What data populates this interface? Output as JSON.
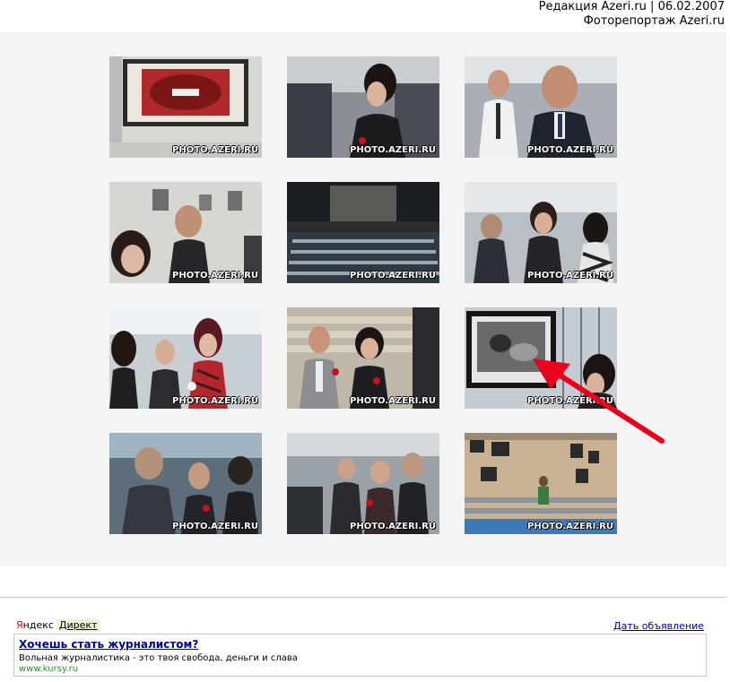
{
  "header": {
    "line1": "Редакция Azeri.ru | 06.02.2007",
    "line2": "Фоторепортаж Azeri.ru"
  },
  "gallery": {
    "watermark": "PHOTO.AZERI.RU",
    "photos": [
      {
        "scene": "framed-painting"
      },
      {
        "scene": "woman-dark-hair"
      },
      {
        "scene": "men-in-suits"
      },
      {
        "scene": "woman-and-man-gallery"
      },
      {
        "scene": "auditorium-screen"
      },
      {
        "scene": "crowd-reception"
      },
      {
        "scene": "women-guests"
      },
      {
        "scene": "couple-on-stairs"
      },
      {
        "scene": "framed-photo-with-arrow"
      },
      {
        "scene": "guests-standing"
      },
      {
        "scene": "seated-audience"
      },
      {
        "scene": "exhibition-hall"
      }
    ],
    "highlight_color": "#e8001c"
  },
  "ads": {
    "brand_y": "Я",
    "brand_rest": "ндекс",
    "direct_label": "Директ",
    "place_ad_label": "Дать объявление",
    "item": {
      "title": "Хочешь стать журналистом?",
      "description": "Вольная журналистика - это твоя свобода, деньги и слава",
      "url": "www.kursy.ru"
    }
  }
}
